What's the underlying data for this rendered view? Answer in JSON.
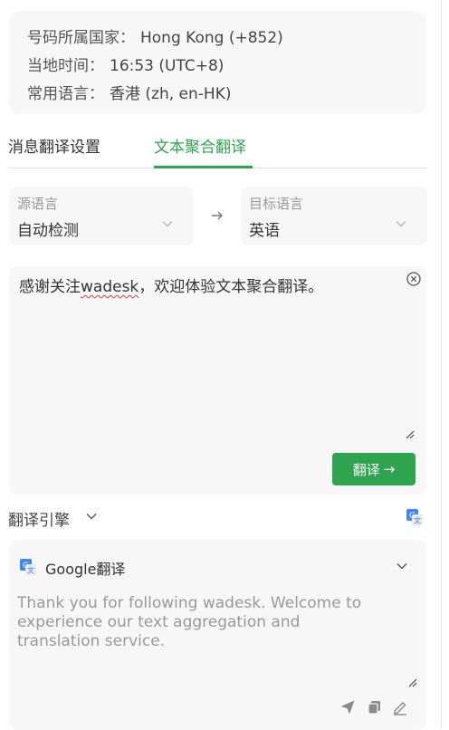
{
  "info": {
    "country_label": "号码所属国家：",
    "country_value": "Hong Kong (+852)",
    "time_label": "当地时间：",
    "time_value": "16:53 (UTC+8)",
    "lang_label": "常用语言：",
    "lang_value": "香港 (zh, en-HK)"
  },
  "tabs": [
    {
      "label": "消息翻译设置",
      "active": false
    },
    {
      "label": "文本聚合翻译",
      "active": true
    }
  ],
  "source_lang": {
    "caption": "源语言",
    "value": "自动检测"
  },
  "target_lang": {
    "caption": "目标语言",
    "value": "英语"
  },
  "source": {
    "text_before": "感谢关注",
    "text_misspelled": "wadesk",
    "text_after": "，欢迎体验文本聚合翻译。"
  },
  "translate_button": {
    "label": "翻译",
    "arrow": "→"
  },
  "engine": {
    "label": "翻译引擎"
  },
  "result": {
    "engine_name": "Google翻译",
    "text": "Thank you for following wadesk. Welcome to experience our text aggregation and translation service."
  },
  "colors": {
    "accent": "#2ea44f",
    "panel": "#f7f7f7",
    "muted": "#999999"
  },
  "icons": [
    "chevron-down-icon",
    "arrow-right-icon",
    "clear-circle-icon",
    "resize-grip-icon",
    "google-translate-icon",
    "send-icon",
    "copy-icon",
    "edit-icon"
  ]
}
